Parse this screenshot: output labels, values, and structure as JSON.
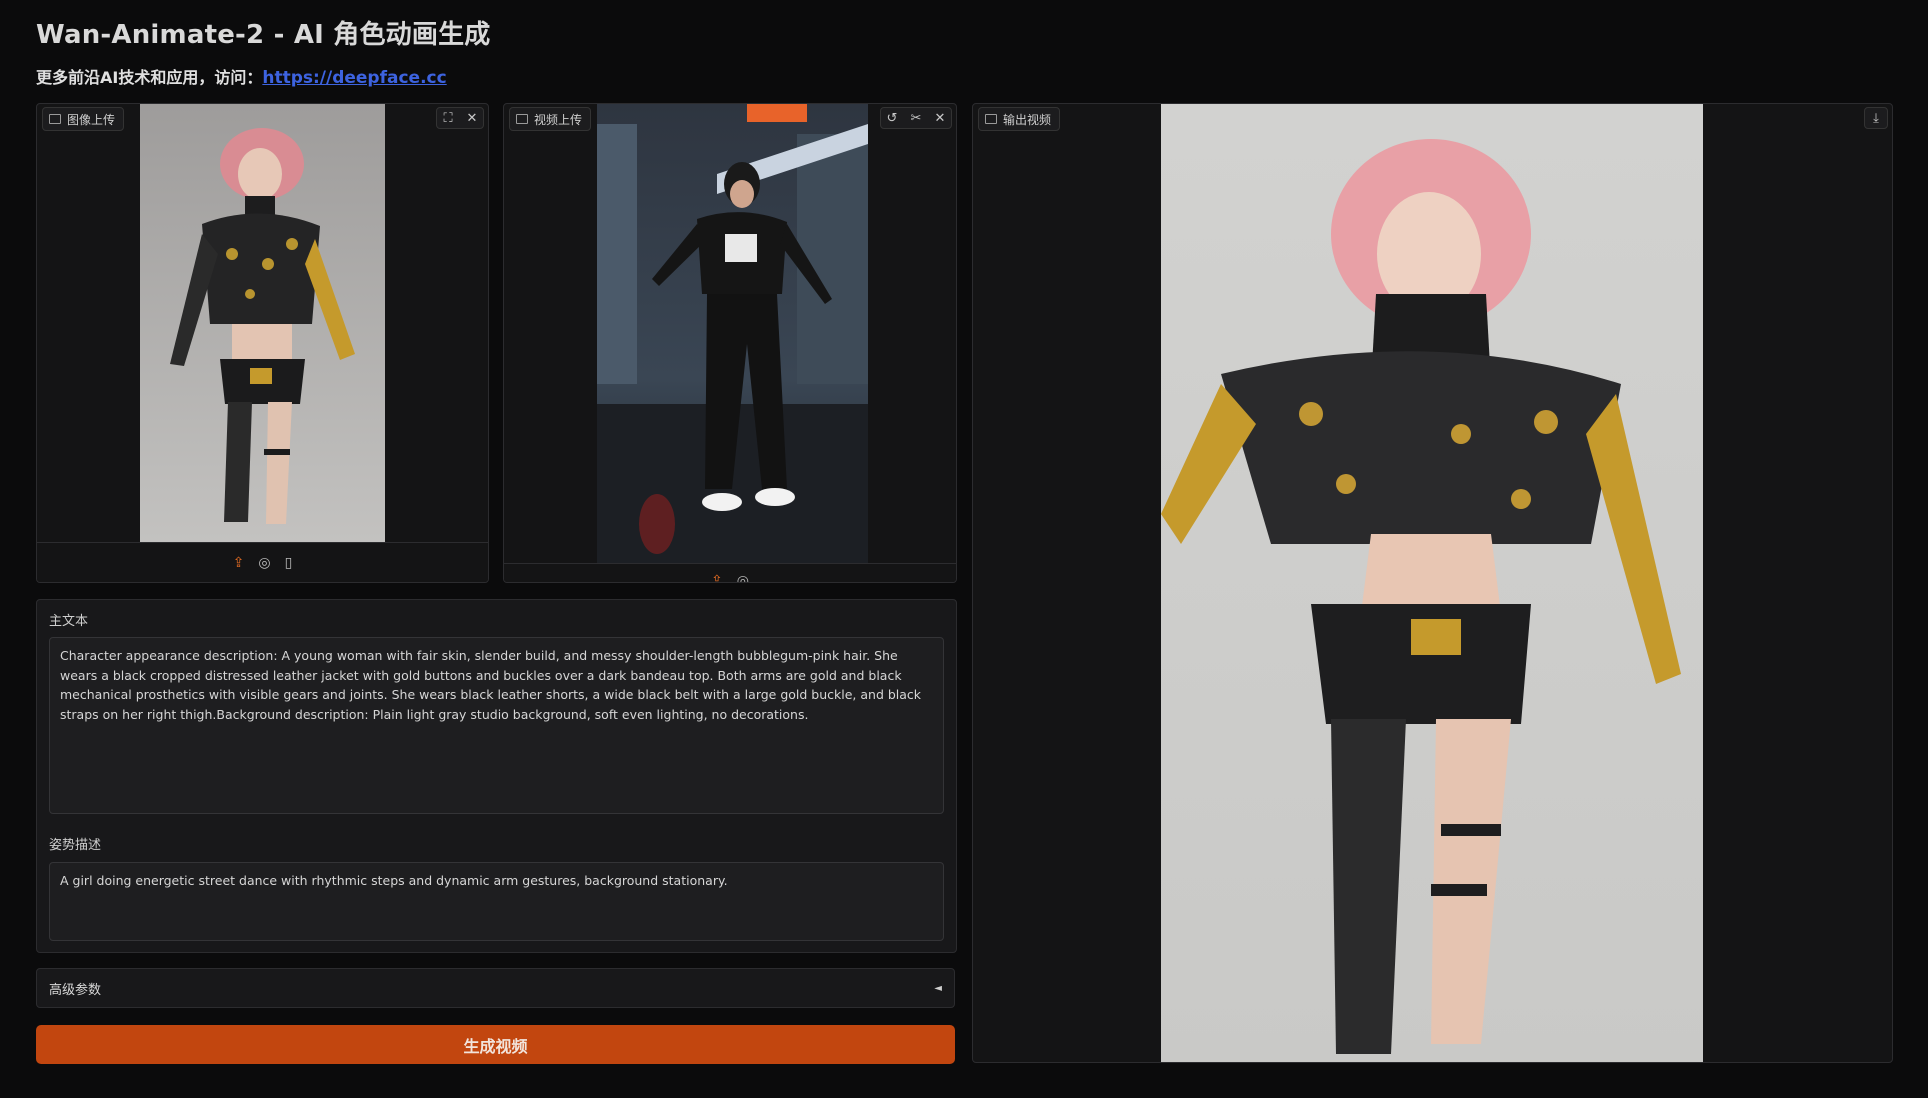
{
  "header": {
    "title": "Wan-Animate-2 - AI 角色动画生成",
    "subtitle_prefix": "更多前沿AI技术和应用，访问：",
    "link_text": "https://deepface.cc"
  },
  "image_upload": {
    "label": "图像上传",
    "tools": [
      "fullscreen-icon",
      "close-icon"
    ],
    "bottom_tools": [
      "upload-icon",
      "webcam-icon",
      "clipboard-icon"
    ]
  },
  "video_upload": {
    "label": "视频上传",
    "tools": [
      "undo-icon",
      "scissors-icon",
      "close-icon"
    ],
    "bottom_tools": [
      "upload-icon",
      "webcam-icon"
    ]
  },
  "output_video": {
    "label": "输出视频",
    "tools": [
      "download-icon"
    ]
  },
  "prompt": {
    "label": "主文本",
    "value": "Character appearance description: A young woman with fair skin, slender build, and messy shoulder-length bubblegum-pink hair. She wears a black cropped distressed leather jacket with gold buttons and buckles over a dark bandeau top. Both arms are gold and black mechanical prosthetics with visible gears and joints. She wears black leather shorts, a wide black belt with a large gold buckle, and black straps on her right thigh.Background description: Plain light gray studio background, soft even lighting, no decorations."
  },
  "pose": {
    "label": "姿势描述",
    "value": "A girl doing energetic street dance with rhythmic steps and dynamic arm gestures, background stationary."
  },
  "advanced": {
    "label": "高级参数",
    "caret": "◄"
  },
  "generate_button": "生成视频",
  "colors": {
    "accent": "#c2460f",
    "link": "#3d63e0",
    "background": "#0b0b0c"
  }
}
